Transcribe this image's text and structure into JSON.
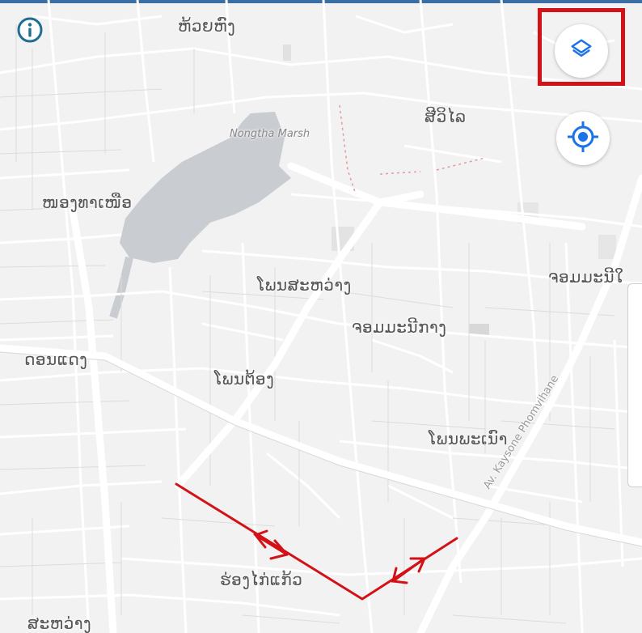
{
  "map": {
    "labels": {
      "l1": "ຫ້ວຍຫົງ",
      "l2": "ສີວິໄລ",
      "l3": "Nongtha Marsh",
      "l4": "ໜອງທາເໜືອ",
      "l5": "ໂພນສະຫວ່າງ",
      "l6": "ຈອມມະນີກາງ",
      "l7": "ຈອມມະນີໃ",
      "l8": "ດອນແດງ",
      "l9": "ໂພນຕ້ອງ",
      "l10": "ໂພນພະເນົາ",
      "l11": "ຮ່ອງໄກ່ແກ້ວ",
      "l12": "ສະຫວ່າງ",
      "road": "Av. Kaysone Phomvihane"
    }
  },
  "controls": {
    "info_icon": "info-icon",
    "layers_icon": "layers-icon",
    "location_icon": "my-location-icon"
  },
  "colors": {
    "accent": "#1a73e8",
    "annotation": "#d31218",
    "water": "#c9ccd0"
  }
}
